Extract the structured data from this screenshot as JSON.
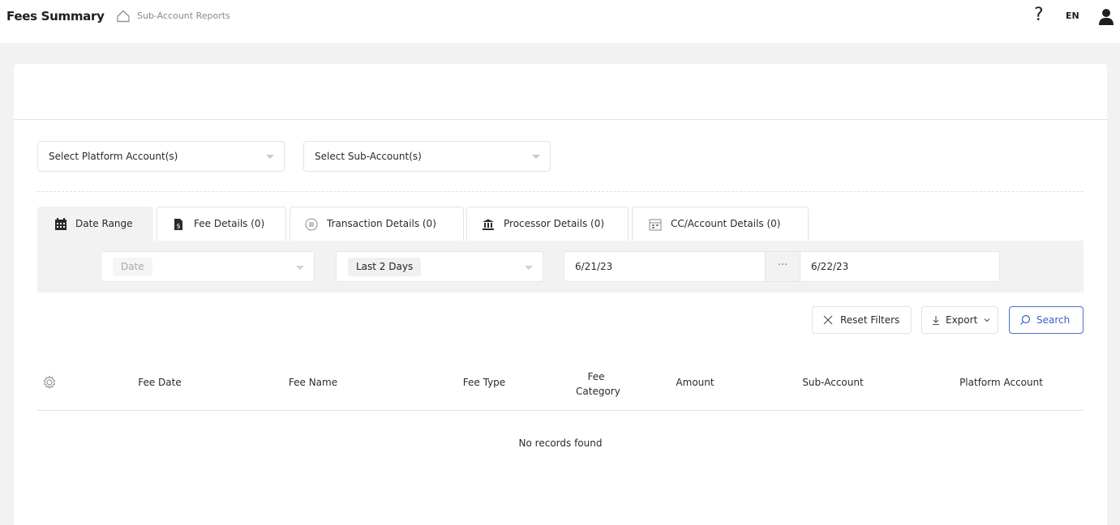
{
  "header": {
    "title": "Fees Summary",
    "breadcrumb": "Sub-Account Reports",
    "help_icon": "?",
    "language": "EN"
  },
  "selectors": {
    "platform_account": "Select Platform Account(s)",
    "sub_account": "Select Sub-Account(s)"
  },
  "tabs": [
    {
      "label": "Date Range",
      "icon": "calendar-icon",
      "active": true
    },
    {
      "label": "Fee Details (0)",
      "icon": "fee-document-icon",
      "active": false
    },
    {
      "label": "Transaction Details (0)",
      "icon": "transaction-list-icon",
      "active": false
    },
    {
      "label": "Processor Details (0)",
      "icon": "bank-icon",
      "active": false
    },
    {
      "label": "CC/Account Details (0)",
      "icon": "credit-card-icon",
      "active": false
    }
  ],
  "filters": {
    "date_field": "Date",
    "range": "Last 2 Days",
    "start_date": "6/21/23",
    "range_separator": "···",
    "end_date": "6/22/23"
  },
  "actions": {
    "reset": "Reset Filters",
    "export": "Export",
    "search": "Search"
  },
  "table": {
    "columns": [
      "Fee Date",
      "Fee Name",
      "Fee Type",
      "Fee Category",
      "Amount",
      "Sub-Account",
      "Platform Account"
    ],
    "empty_message": "No records found"
  },
  "colors": {
    "accent": "#3a5fc8",
    "background": "#f2f2f2"
  }
}
